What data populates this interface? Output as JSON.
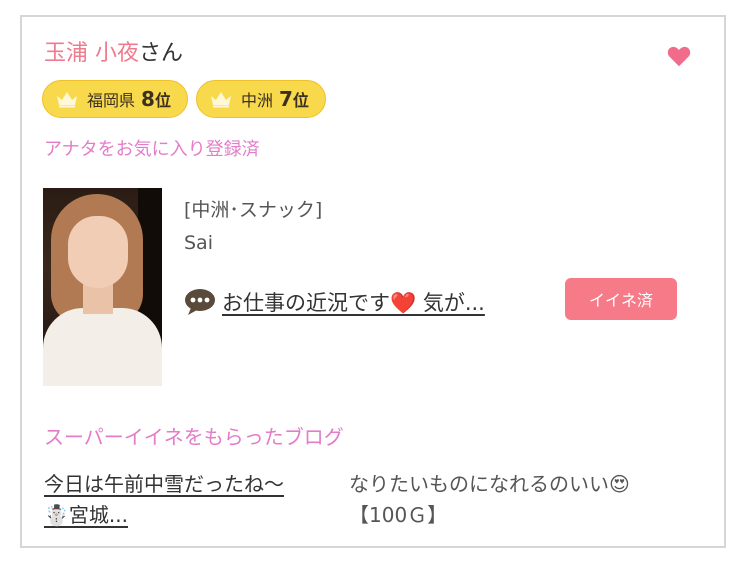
{
  "profile": {
    "name": "玉浦 小夜",
    "honorific": "さん",
    "favorite_status": "アナタをお気に入り登録済"
  },
  "badges": [
    {
      "area": "福岡県",
      "rank_number": "8",
      "rank_unit": "位"
    },
    {
      "area": "中洲",
      "rank_number": "7",
      "rank_unit": "位"
    }
  ],
  "shop": {
    "category": "[中洲･スナック]",
    "name": "Sai"
  },
  "post": {
    "title": "お仕事の近況です❤️ 気が...",
    "like_label": "イイネ済"
  },
  "super_like_section": {
    "title": "スーパーイイネをもらったブログ",
    "blog_title_line1": "今日は午前中雪だったね〜",
    "blog_title_line2": "☃️宮城...",
    "comment_line1": "なりたいものになれるのいい😍",
    "comment_line2": "【100Ｇ】"
  },
  "colors": {
    "name": "#ef7b8e",
    "heart": "#f06c8a",
    "badge": "#f9d94c",
    "accent_text": "#e37cc9",
    "like_button": "#f77a89"
  },
  "icons": {
    "heart": "heart-icon",
    "crown": "crown-icon",
    "speech": "speech-bubble-icon"
  }
}
